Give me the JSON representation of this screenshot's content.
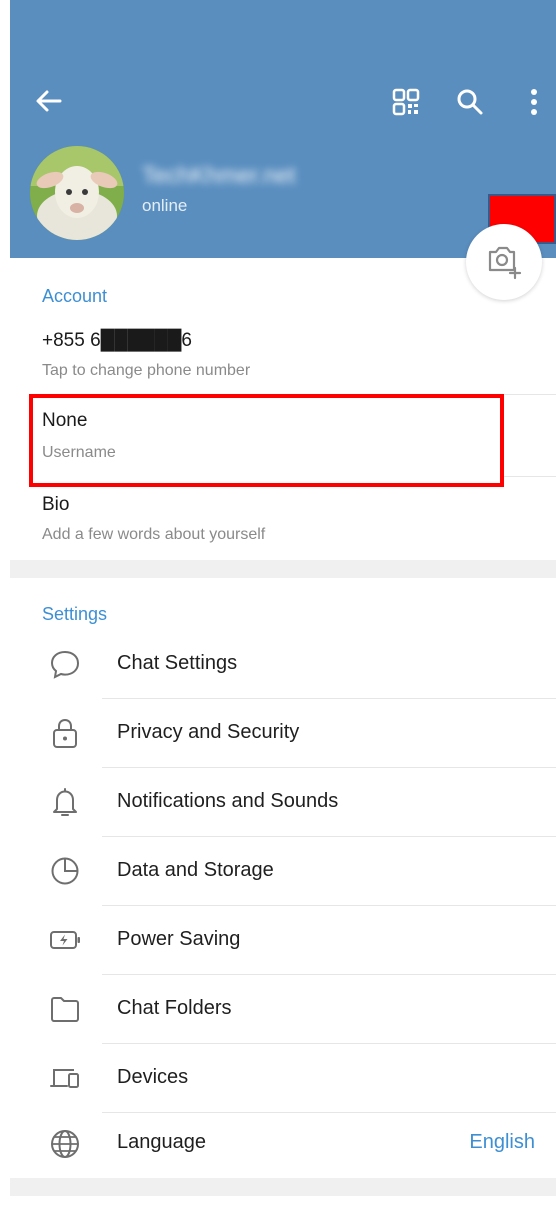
{
  "header": {
    "profile_name": "TechKhmer.net",
    "status": "online"
  },
  "account": {
    "section_title": "Account",
    "phone_value": "+855 6██████6",
    "phone_hint": "Tap to change phone number",
    "username_value": "None",
    "username_hint": "Username",
    "bio_value": "Bio",
    "bio_hint": "Add a few words about yourself"
  },
  "settings": {
    "section_title": "Settings",
    "items": [
      {
        "label": "Chat Settings",
        "icon": "chat-bubble-icon"
      },
      {
        "label": "Privacy and Security",
        "icon": "lock-icon"
      },
      {
        "label": "Notifications and Sounds",
        "icon": "bell-icon"
      },
      {
        "label": "Data and Storage",
        "icon": "pie-chart-icon"
      },
      {
        "label": "Power Saving",
        "icon": "battery-icon"
      },
      {
        "label": "Chat Folders",
        "icon": "folder-icon"
      },
      {
        "label": "Devices",
        "icon": "devices-icon"
      },
      {
        "label": "Language",
        "icon": "globe-icon",
        "value": "English"
      }
    ]
  },
  "colors": {
    "header_bg": "#5a8ebf",
    "accent": "#3d8fd4",
    "highlight": "#ff0000"
  }
}
